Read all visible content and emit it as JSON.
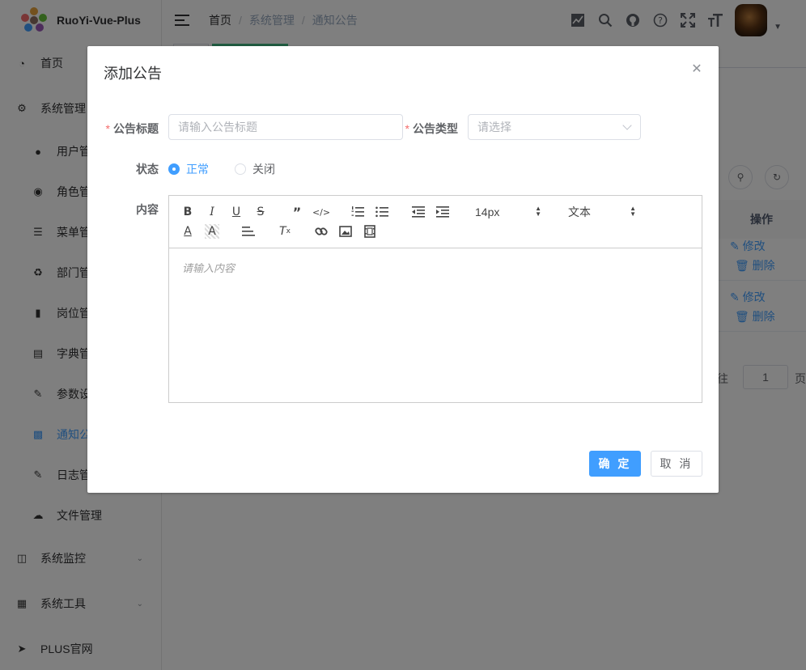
{
  "app": {
    "title": "RuoYi-Vue-Plus"
  },
  "sidebar": {
    "items": [
      {
        "label": "首页",
        "icon": "dashboard-icon",
        "level": 0
      },
      {
        "label": "系统管理",
        "icon": "gear-icon",
        "level": 0
      },
      {
        "label": "用户管",
        "icon": "user-icon",
        "level": 1
      },
      {
        "label": "角色管",
        "icon": "peoples-icon",
        "level": 1
      },
      {
        "label": "菜单管",
        "icon": "tree-table-icon",
        "level": 1
      },
      {
        "label": "部门管",
        "icon": "tree-icon",
        "level": 1
      },
      {
        "label": "岗位管",
        "icon": "post-icon",
        "level": 1
      },
      {
        "label": "字典管",
        "icon": "dict-icon",
        "level": 1
      },
      {
        "label": "参数设",
        "icon": "edit-icon",
        "level": 1
      },
      {
        "label": "通知公",
        "icon": "message-icon",
        "level": 1,
        "active": true
      },
      {
        "label": "日志管",
        "icon": "log-icon",
        "level": 1
      },
      {
        "label": "文件管理",
        "icon": "upload-icon",
        "level": 1
      },
      {
        "label": "系统监控",
        "icon": "monitor-icon",
        "level": 0,
        "expandable": true
      },
      {
        "label": "系统工具",
        "icon": "tool-icon",
        "level": 0,
        "expandable": true
      },
      {
        "label": "PLUS官网",
        "icon": "guide-icon",
        "level": 0
      }
    ]
  },
  "header": {
    "breadcrumb": [
      "首页",
      "系统管理",
      "通知公告"
    ],
    "separator": "/",
    "icons": [
      "chart-icon",
      "search-icon",
      "github-icon",
      "question-icon",
      "fullscreen-icon",
      "font-size-icon"
    ]
  },
  "background": {
    "table_header": "操作",
    "actions": {
      "edit": "修改",
      "delete": "删除"
    },
    "pagination": {
      "goto": "前往",
      "page": "1",
      "page_suffix": "页"
    }
  },
  "dialog": {
    "title": "添加公告",
    "form": {
      "title_label": "公告标题",
      "title_placeholder": "请输入公告标题",
      "type_label": "公告类型",
      "type_placeholder": "请选择",
      "status_label": "状态",
      "status_options": [
        {
          "label": "正常",
          "checked": true
        },
        {
          "label": "关闭",
          "checked": false
        }
      ],
      "content_label": "内容"
    },
    "editor": {
      "font_size": "14px",
      "heading": "文本",
      "placeholder": "请输入内容"
    },
    "buttons": {
      "confirm": "确 定",
      "cancel": "取 消"
    }
  },
  "colors": {
    "primary": "#409eff",
    "required": "#f56c6c",
    "overlay": "rgba(0,0,0,0.5)"
  }
}
